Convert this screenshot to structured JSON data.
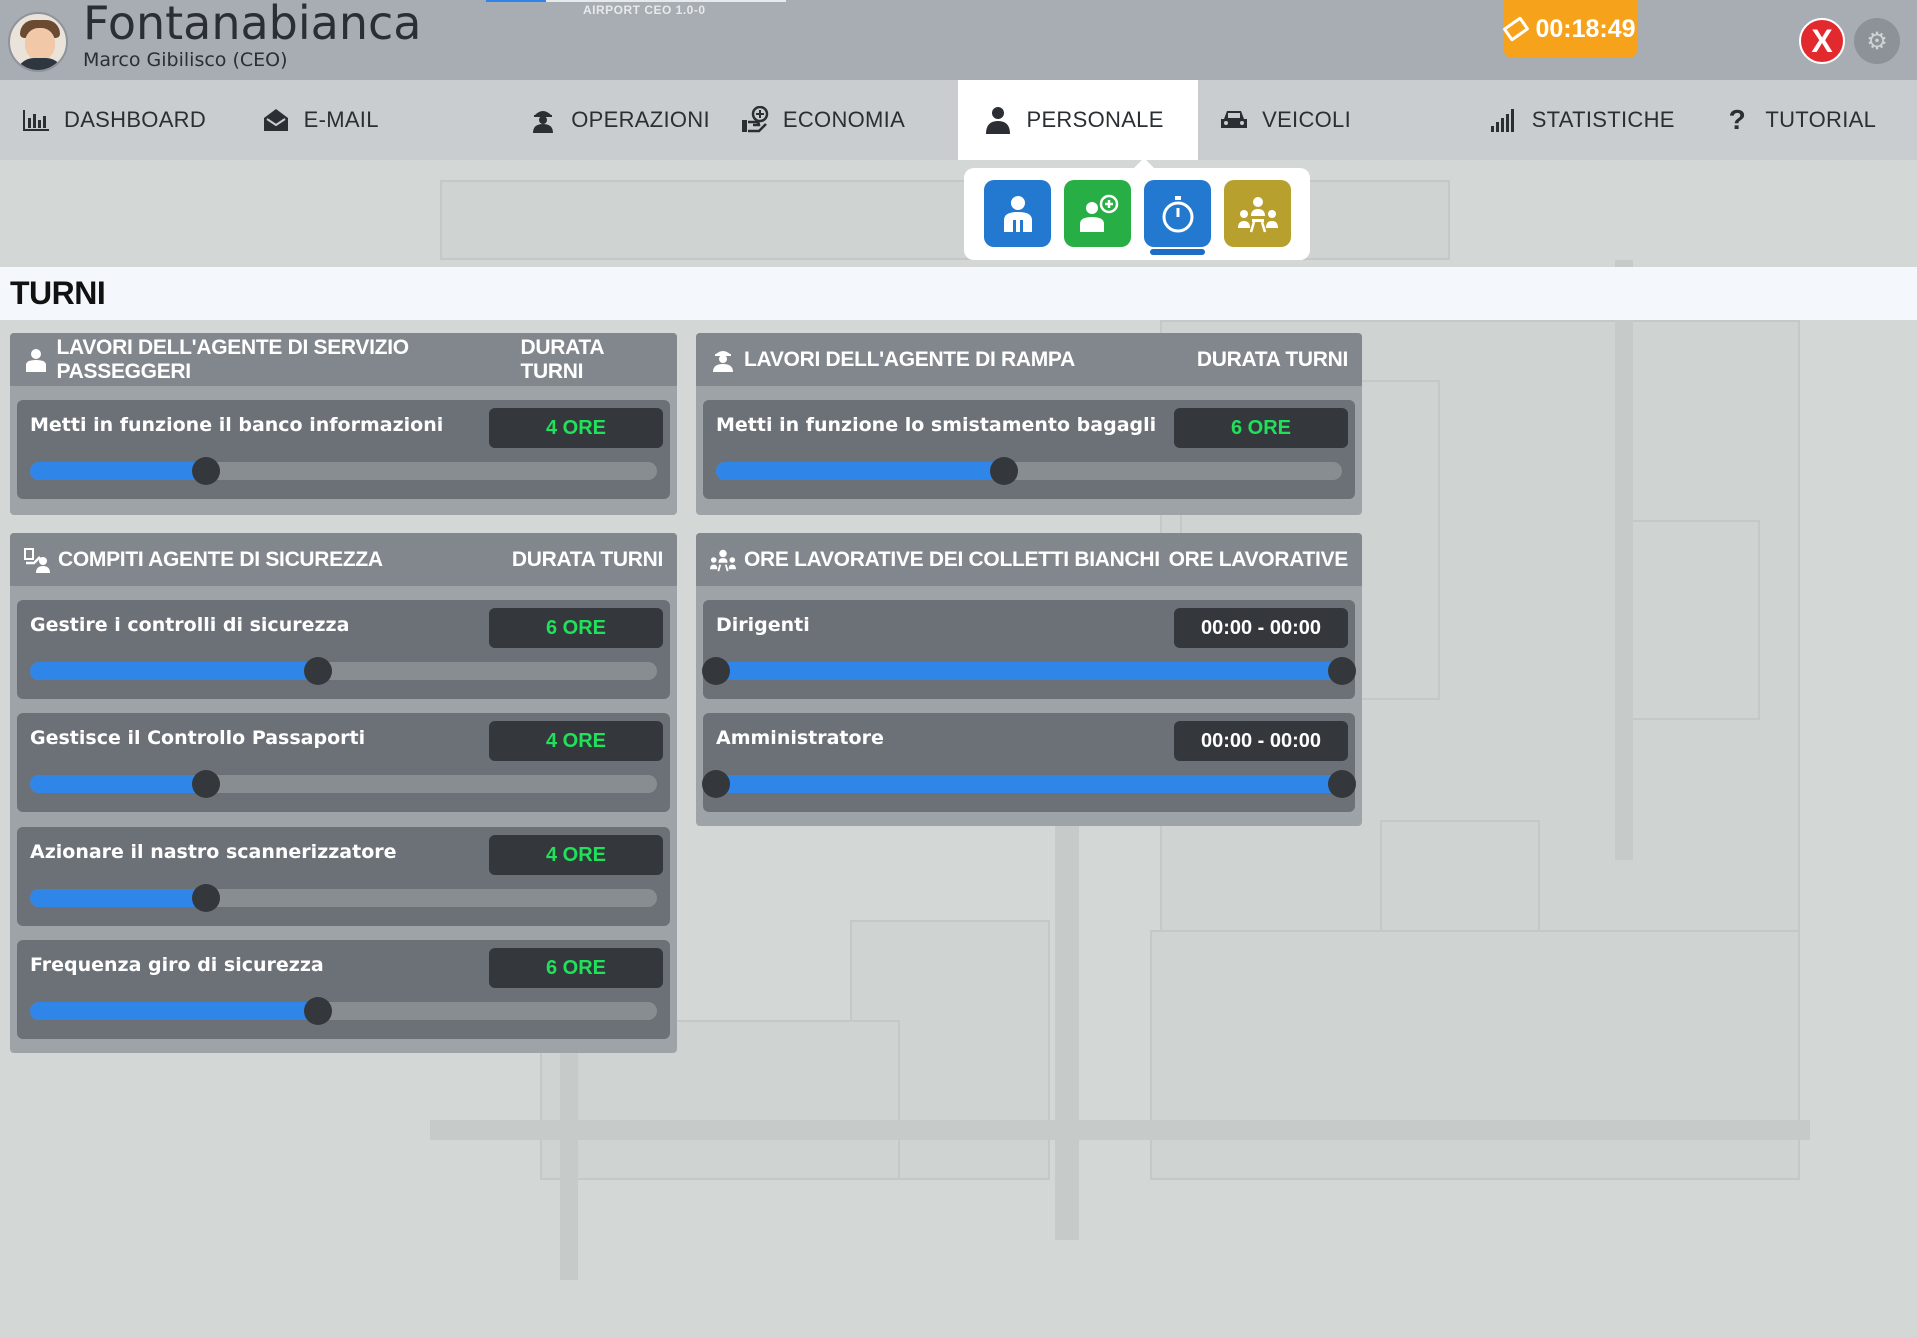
{
  "header": {
    "airport_name": "Fontanabianca",
    "ceo_name": "Marco Gibilisco (CEO)",
    "version": "AIRPORT CEO 1.0-0",
    "clock": "00:18:49",
    "close_label": "X"
  },
  "nav": {
    "items": [
      {
        "label": "DASHBOARD",
        "icon": "dashboard-icon"
      },
      {
        "label": "E-MAIL",
        "icon": "mail-icon"
      },
      {
        "label": "OPERAZIONI",
        "icon": "operations-icon"
      },
      {
        "label": "ECONOMIA",
        "icon": "economy-icon"
      },
      {
        "label": "PERSONALE",
        "icon": "staff-icon"
      },
      {
        "label": "VEICOLI",
        "icon": "vehicle-icon"
      },
      {
        "label": "STATISTICHE",
        "icon": "statistics-icon"
      },
      {
        "label": "TUTORIAL",
        "icon": "help-icon"
      }
    ],
    "active": "PERSONALE"
  },
  "sub_icons": [
    {
      "icon": "staff-list-icon",
      "color": "#2378cf"
    },
    {
      "icon": "hire-staff-icon",
      "color": "#27ae45"
    },
    {
      "icon": "shift-timer-icon",
      "color": "#2378cf"
    },
    {
      "icon": "staff-meeting-icon",
      "color": "#b8a02e"
    }
  ],
  "page_title": "TURNI",
  "panels": {
    "passenger": {
      "title": "LAVORI DELL'AGENTE DI SERVIZIO PASSEGGERI",
      "right": "DURATA TURNI",
      "rows": [
        {
          "label": "Metti in funzione il banco informazioni",
          "value": "4 ORE",
          "level": 0.28
        }
      ]
    },
    "ramp": {
      "title": "LAVORI DELL'AGENTE DI RAMPA",
      "right": "DURATA TURNI",
      "rows": [
        {
          "label": "Metti in funzione lo smistamento bagagli",
          "value": "6 ORE",
          "level": 0.46
        }
      ]
    },
    "security": {
      "title": "COMPITI AGENTE DI SICUREZZA",
      "right": "DURATA TURNI",
      "rows": [
        {
          "label": "Gestire i controlli di sicurezza",
          "value": "6 ORE",
          "level": 0.46
        },
        {
          "label": "Gestisce il Controllo Passaporti",
          "value": "4 ORE",
          "level": 0.28
        },
        {
          "label": "Azionare il nastro scannerizzatore",
          "value": "4 ORE",
          "level": 0.28
        },
        {
          "label": "Frequenza giro di sicurezza",
          "value": "6 ORE",
          "level": 0.46
        }
      ]
    },
    "white_collar": {
      "title": "ORE LAVORATIVE DEI COLLETTI BIANCHI",
      "right": "ORE LAVORATIVE",
      "rows": [
        {
          "label": "Dirigenti",
          "value": "00:00 - 00:00",
          "range": [
            0,
            1
          ]
        },
        {
          "label": "Amministratore",
          "value": "00:00 - 00:00",
          "range": [
            0,
            1
          ]
        }
      ]
    }
  },
  "colors": {
    "accent_blue": "#2f86e8",
    "badge_green": "#21e05a",
    "clock_orange": "#f7a21b",
    "close_red": "#e22a2e"
  }
}
